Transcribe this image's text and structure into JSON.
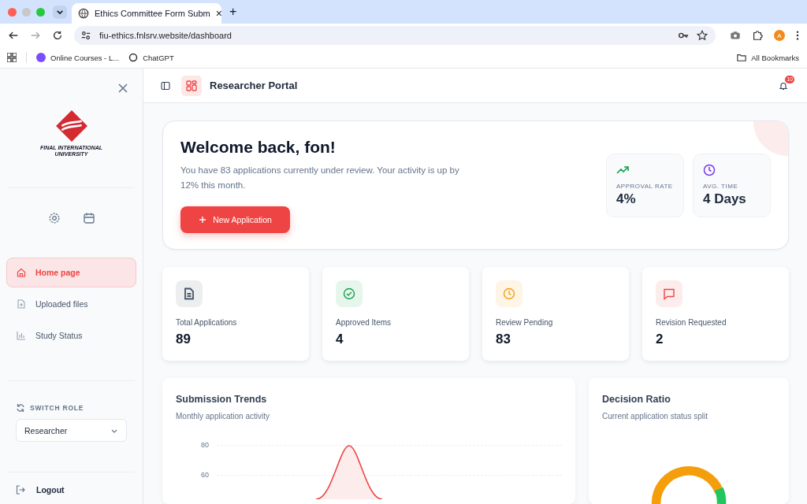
{
  "browser": {
    "tab_title": "Ethics Committee Form Subm",
    "tab_close": "×",
    "new_tab": "+",
    "url": "fiu-ethics.fnlsrv.website/dashboard",
    "profile": "A",
    "bookmarks": [
      "Online Courses - L...",
      "ChatGPT"
    ],
    "all_bookmarks": "All Bookmarks"
  },
  "sidebar": {
    "logo_text": "FINAL INTERNATIONAL UNIVERSITY",
    "items": [
      {
        "label": "Home page",
        "kind": "home",
        "selected": true
      },
      {
        "label": "Uploaded files",
        "kind": "file",
        "selected": false
      },
      {
        "label": "Study Status",
        "kind": "chart",
        "selected": false
      }
    ],
    "switch_role": {
      "label": "SWITCH ROLE",
      "value": "Researcher"
    },
    "logout": "Logout"
  },
  "header": {
    "title": "Researcher Portal",
    "notification_badge": "10"
  },
  "welcome": {
    "title": "Welcome back, fon!",
    "text": "You have 83 applications currently under review. Your activity is up by 12% this month.",
    "button": "New Application",
    "metrics": [
      {
        "kind": "trend",
        "label": "APPROVAL RATE",
        "value": "4%"
      },
      {
        "kind": "time",
        "label": "AVG. TIME",
        "value": "4 Days"
      }
    ]
  },
  "stats": [
    {
      "kind": "total",
      "color": "#475569",
      "label": "Total Applications",
      "value": "89"
    },
    {
      "kind": "approved",
      "color": "#16a34a",
      "label": "Approved Items",
      "value": "4"
    },
    {
      "kind": "pending",
      "color": "#f59e0b",
      "label": "Review Pending",
      "value": "83"
    },
    {
      "kind": "revision",
      "color": "#ef4444",
      "label": "Revision Requested",
      "value": "2"
    }
  ],
  "trends": {
    "title": "Submission Trends",
    "subtitle": "Monthly application activity",
    "y_tick_labels": [
      "80",
      "60"
    ]
  },
  "ratio": {
    "title": "Decision Ratio",
    "subtitle": "Current application status split"
  }
}
